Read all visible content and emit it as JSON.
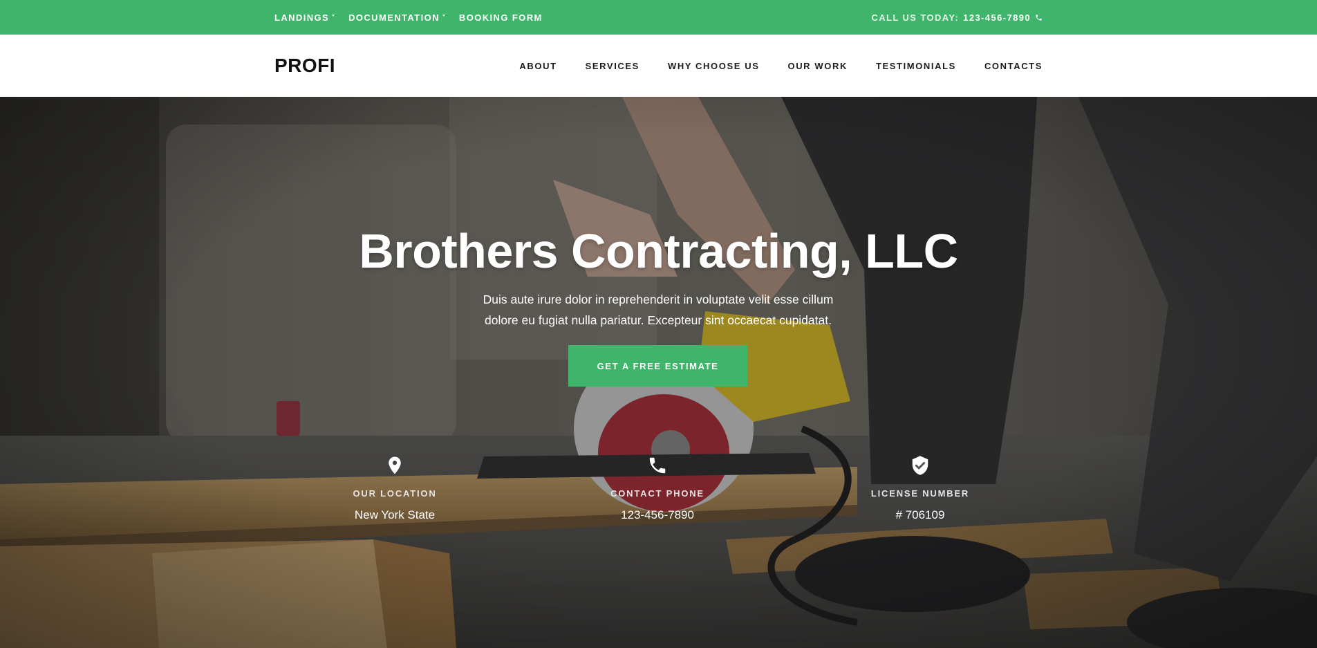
{
  "topbar": {
    "nav": [
      {
        "label": "LANDINGS",
        "has_dropdown": true
      },
      {
        "label": "DOCUMENTATION",
        "has_dropdown": true
      },
      {
        "label": "BOOKING FORM",
        "has_dropdown": false
      }
    ],
    "call_label": "CALL US TODAY:",
    "call_number": "123-456-7890",
    "icon": "phone-icon"
  },
  "header": {
    "logo": "PROFI",
    "nav": [
      "ABOUT",
      "SERVICES",
      "WHY CHOOSE US",
      "OUR WORK",
      "TESTIMONIALS",
      "CONTACTS"
    ]
  },
  "hero": {
    "title": "Brothers Contracting, LLC",
    "subtitle_line1": "Duis aute irure dolor in reprehenderit in voluptate velit esse cillum",
    "subtitle_line2": "dolore eu fugiat nulla pariatur. Excepteur sint occaecat cupidatat.",
    "cta_label": "GET A FREE ESTIMATE",
    "info": [
      {
        "icon": "map-pin-icon",
        "label": "OUR LOCATION",
        "value": "New York State"
      },
      {
        "icon": "phone-icon",
        "label": "CONTACT PHONE",
        "value": "123-456-7890"
      },
      {
        "icon": "shield-check-icon",
        "label": "LICENSE NUMBER",
        "value": "# 706109"
      }
    ]
  },
  "colors": {
    "accent": "#3fb46b",
    "header_bg": "#ffffff",
    "text_dark": "#111111"
  }
}
